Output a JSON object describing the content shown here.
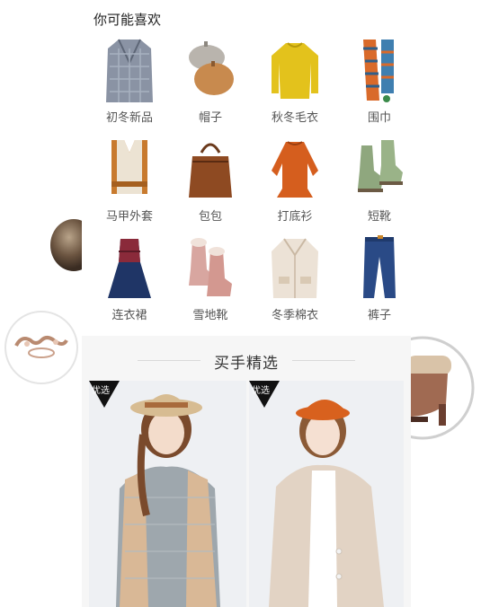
{
  "recommend": {
    "title": "你可能喜欢",
    "items": [
      {
        "label": "初冬新品",
        "icon": "coat-icon"
      },
      {
        "label": "帽子",
        "icon": "beret-hat-icon"
      },
      {
        "label": "秋冬毛衣",
        "icon": "sweater-icon"
      },
      {
        "label": "围巾",
        "icon": "scarf-icon"
      },
      {
        "label": "马甲外套",
        "icon": "vest-icon"
      },
      {
        "label": "包包",
        "icon": "bag-icon"
      },
      {
        "label": "打底衫",
        "icon": "blouse-icon"
      },
      {
        "label": "短靴",
        "icon": "ankle-boots-icon"
      },
      {
        "label": "连衣裙",
        "icon": "dress-icon"
      },
      {
        "label": "雪地靴",
        "icon": "snow-boots-icon"
      },
      {
        "label": "冬季棉衣",
        "icon": "cotton-coat-icon"
      },
      {
        "label": "裤子",
        "icon": "jeans-icon"
      }
    ]
  },
  "section": {
    "title": "买手精选"
  },
  "products": [
    {
      "badge": "优选"
    },
    {
      "badge": "优选"
    }
  ],
  "colors": {
    "badge": "#111111",
    "divider": "#d9d9d9",
    "background": "#f6f6f6"
  }
}
